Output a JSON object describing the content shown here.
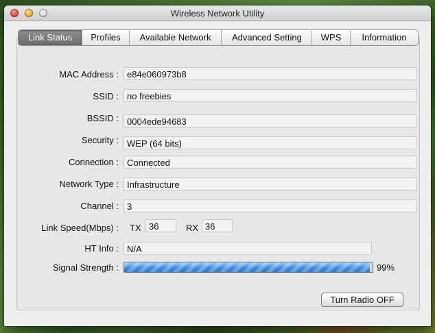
{
  "window": {
    "title": "Wireless Network Utility"
  },
  "tabs": [
    {
      "label": "Link Status",
      "active": true
    },
    {
      "label": "Profiles"
    },
    {
      "label": "Available Network"
    },
    {
      "label": "Advanced Setting"
    },
    {
      "label": "WPS"
    },
    {
      "label": "Information"
    }
  ],
  "fields": {
    "mac": {
      "label": "MAC Address :",
      "value": "e84e060973b8"
    },
    "ssid": {
      "label": "SSID :",
      "value": "no freebies"
    },
    "bssid": {
      "label": "BSSID :",
      "value": "0004ede94683"
    },
    "security": {
      "label": "Security :",
      "value": "WEP (64 bits)"
    },
    "connection": {
      "label": "Connection :",
      "value": "Connected"
    },
    "network_type": {
      "label": "Network Type :",
      "value": "Infrastructure"
    },
    "channel": {
      "label": "Channel :",
      "value": "3"
    },
    "link_speed": {
      "label": "Link Speed(Mbps) :",
      "tx_label": "TX",
      "tx": "36",
      "rx_label": "RX",
      "rx": "36"
    },
    "ht_info": {
      "label": "HT Info :",
      "value": "N/A"
    },
    "signal": {
      "label": "Signal Strength :",
      "percent": 99,
      "percent_text": "99%"
    }
  },
  "buttons": {
    "radio": "Turn Radio OFF"
  },
  "colors": {
    "progress": "#3d8ee0",
    "active_tab": "#7a7a7a"
  }
}
